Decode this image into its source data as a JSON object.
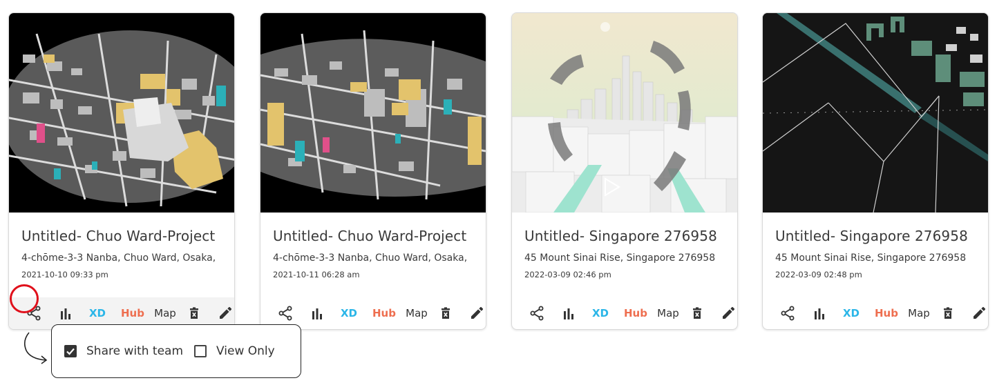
{
  "cards": [
    {
      "title": "Untitled- Chuo Ward-Project",
      "address": "4-chōme-3-3 Nanba, Chuo Ward, Osaka,",
      "date": "2021-10-10 09:33 pm",
      "thumbnail": "osaka-city-model-dark"
    },
    {
      "title": "Untitled- Chuo Ward-Project",
      "address": "4-chōme-3-3 Nanba, Chuo Ward, Osaka,",
      "date": "2021-10-11 06:28 am",
      "thumbnail": "osaka-city-model-dark"
    },
    {
      "title": "Untitled- Singapore 276958",
      "address": "45 Mount Sinai Rise, Singapore 276958",
      "date": "2022-03-09 02:46 pm",
      "thumbnail": "singapore-city-model-light"
    },
    {
      "title": "Untitled- Singapore 276958",
      "address": "45 Mount Sinai Rise, Singapore 276958",
      "date": "2022-03-09 02:48 pm",
      "thumbnail": "singapore-site-map-dark"
    }
  ],
  "toolbar": {
    "share_icon": "share-icon",
    "stats_icon": "bar-chart-icon",
    "xd_label": "XD",
    "hub_label": "Hub",
    "map_label": "Map",
    "delete_icon": "trash-icon",
    "edit_icon": "pencil-icon"
  },
  "share_popup": {
    "share_with_team_label": "Share with team",
    "share_with_team_checked": true,
    "view_only_label": "View Only",
    "view_only_checked": false
  },
  "colors": {
    "xd": "#2bb6e8",
    "hub": "#ee6e4f",
    "highlight": "#e0101b",
    "building_yellow": "#e3c36c",
    "building_teal": "#2bb0b8",
    "building_pink": "#e0508a"
  }
}
